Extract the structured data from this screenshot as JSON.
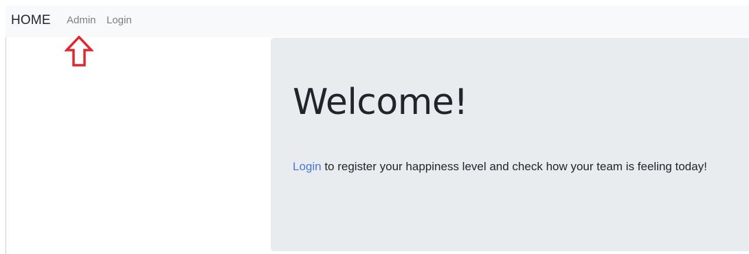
{
  "navbar": {
    "brand": "HOME",
    "links": [
      {
        "label": "Admin"
      },
      {
        "label": "Login"
      }
    ]
  },
  "annotation": {
    "arrow_color": "#e3262e",
    "icon": "up-arrow-icon"
  },
  "jumbotron": {
    "heading": "Welcome!",
    "lead_link": "Login",
    "lead_text": " to register your happiness level and check how your team is feeling today!"
  },
  "colors": {
    "navbar_bg": "#f8f9fa",
    "jumbotron_bg": "#e9ecef",
    "link": "#4a78d6",
    "nav_link": "#7b7f84"
  }
}
